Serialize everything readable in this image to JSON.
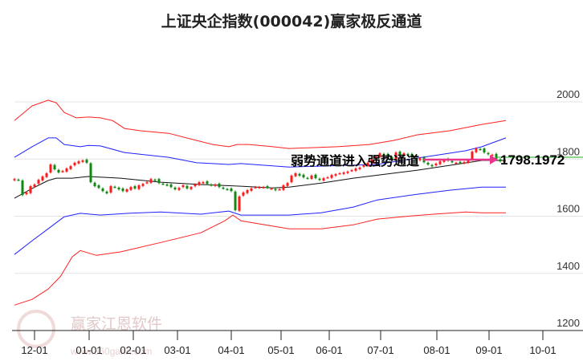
{
  "chart_data": {
    "type": "candlestick",
    "title": "上证央企指数(000042)赢家极反通道",
    "ylim": [
      1200,
      2000
    ],
    "yticks": [
      2000,
      1800,
      1600,
      1400,
      1200
    ],
    "grid": true,
    "x_unit": "candle index",
    "xticks": [
      {
        "label": "12-01",
        "x": 5
      },
      {
        "label": "01-01",
        "x": 18.6
      },
      {
        "label": "02-01",
        "x": 29.6
      },
      {
        "label": "03-01",
        "x": 40.6
      },
      {
        "label": "04-01",
        "x": 54
      },
      {
        "label": "05-01",
        "x": 66.4
      },
      {
        "label": "06-01",
        "x": 78.4
      },
      {
        "label": "07-01",
        "x": 91.2
      },
      {
        "label": "08-01",
        "x": 105.2
      },
      {
        "label": "09-01",
        "x": 118.2
      },
      {
        "label": "10-01",
        "x": 131.6
      }
    ],
    "closes": [
      1730,
      1727,
      1674,
      1683,
      1705,
      1711,
      1727,
      1739,
      1750,
      1781,
      1764,
      1753,
      1758,
      1767,
      1775,
      1787,
      1792,
      1795,
      1787,
      1719,
      1705,
      1699,
      1688,
      1680,
      1705,
      1702,
      1694,
      1688,
      1694,
      1702,
      1697,
      1708,
      1713,
      1719,
      1730,
      1727,
      1716,
      1713,
      1708,
      1702,
      1694,
      1699,
      1708,
      1697,
      1702,
      1711,
      1719,
      1719,
      1713,
      1708,
      1711,
      1702,
      1697,
      1694,
      1688,
      1621,
      1669,
      1683,
      1691,
      1697,
      1702,
      1702,
      1702,
      1699,
      1697,
      1691,
      1694,
      1708,
      1716,
      1742,
      1750,
      1742,
      1736,
      1733,
      1742,
      1733,
      1727,
      1733,
      1736,
      1744,
      1747,
      1750,
      1753,
      1756,
      1761,
      1767,
      1770,
      1778,
      1787,
      1798,
      1809,
      1820,
      1815,
      1809,
      1798,
      1823,
      1815,
      1820,
      1815,
      1806,
      1798,
      1803,
      1789,
      1781,
      1775,
      1784,
      1792,
      1798,
      1795,
      1789,
      1787,
      1787,
      1789,
      1795,
      1826,
      1837,
      1834,
      1823,
      1817,
      1815,
      1801,
      1792,
      1795
    ],
    "series": [
      {
        "name": "upper-red",
        "color": "#ff2020",
        "x": [
          0,
          4.4,
          8.4,
          10.4,
          12.4,
          15.4,
          18.4,
          21.4,
          24.4,
          27.4,
          31.4,
          38.4,
          45.4,
          49.4,
          53.4,
          55.4,
          58.4,
          64.4,
          68.4,
          80.4,
          88.4,
          94.4,
          100.4,
          108.4,
          116.4,
          122.4
        ],
        "values": [
          1935,
          1986,
          2006,
          1997,
          1963,
          1944,
          1947,
          1944,
          1935,
          1907,
          1899,
          1890,
          1865,
          1851,
          1843,
          1851,
          1851,
          1843,
          1837,
          1843,
          1851,
          1865,
          1885,
          1899,
          1921,
          1935
        ]
      },
      {
        "name": "upper-blue",
        "color": "#2020ff",
        "x": [
          0,
          4.4,
          8.4,
          10.4,
          12.4,
          16.4,
          18.4,
          21.4,
          27.4,
          38.4,
          45.4,
          49.4,
          53.4,
          56.4,
          68.4,
          90.4,
          96.4,
          104.4,
          112.4,
          116.4,
          122.4
        ],
        "values": [
          1806,
          1843,
          1874,
          1874,
          1851,
          1843,
          1848,
          1846,
          1823,
          1806,
          1787,
          1784,
          1781,
          1784,
          1772,
          1781,
          1795,
          1812,
          1829,
          1843,
          1874
        ]
      },
      {
        "name": "middle-ma",
        "color": "#111111",
        "x": [
          0,
          4.4,
          8.4,
          10.4,
          14.4,
          18.4,
          26.4,
          36.4,
          46.4,
          56.4,
          64.4,
          68.4,
          76.4,
          84.4,
          92.4,
          100.4,
          108.4,
          116.4,
          122.4
        ],
        "values": [
          1663,
          1697,
          1725,
          1733,
          1733,
          1739,
          1733,
          1719,
          1711,
          1705,
          1699,
          1702,
          1716,
          1733,
          1747,
          1761,
          1778,
          1795,
          1795
        ]
      },
      {
        "name": "lower-blue",
        "color": "#2020ff",
        "x": [
          0,
          4.4,
          8.4,
          12.4,
          16.4,
          21.4,
          28.4,
          36.4,
          46.4,
          53.4,
          56.4,
          68.4,
          76.4,
          84.4,
          90.4,
          100.4,
          108.4,
          116.4,
          122.4
        ],
        "values": [
          1466,
          1514,
          1556,
          1598,
          1610,
          1604,
          1610,
          1615,
          1607,
          1618,
          1604,
          1604,
          1612,
          1632,
          1657,
          1677,
          1691,
          1702,
          1702
        ]
      },
      {
        "name": "lower-red",
        "color": "#ff2020",
        "x": [
          0,
          4.4,
          8.4,
          11.4,
          14.4,
          16.4,
          20.4,
          26.4,
          36.4,
          46.4,
          52.4,
          54.4,
          56.4,
          68.4,
          76.4,
          84.4,
          90.4,
          96.4,
          104.4,
          112.4,
          116.4,
          122.4
        ],
        "values": [
          1289,
          1309,
          1345,
          1388,
          1458,
          1480,
          1463,
          1475,
          1508,
          1542,
          1584,
          1604,
          1584,
          1556,
          1556,
          1570,
          1590,
          1598,
          1607,
          1615,
          1612,
          1612
        ]
      }
    ],
    "annotation": "弱势通道进入强势通道",
    "last_value": "1798.1972",
    "colors": {
      "up": "#ff1a1a",
      "down": "#118811",
      "arrow": "#e8358c",
      "grid": "#e3e3e3"
    }
  },
  "watermark": {
    "brand": "赢家江恩软件",
    "url": "www.360gann.com",
    "seal": "江赢恩家"
  }
}
